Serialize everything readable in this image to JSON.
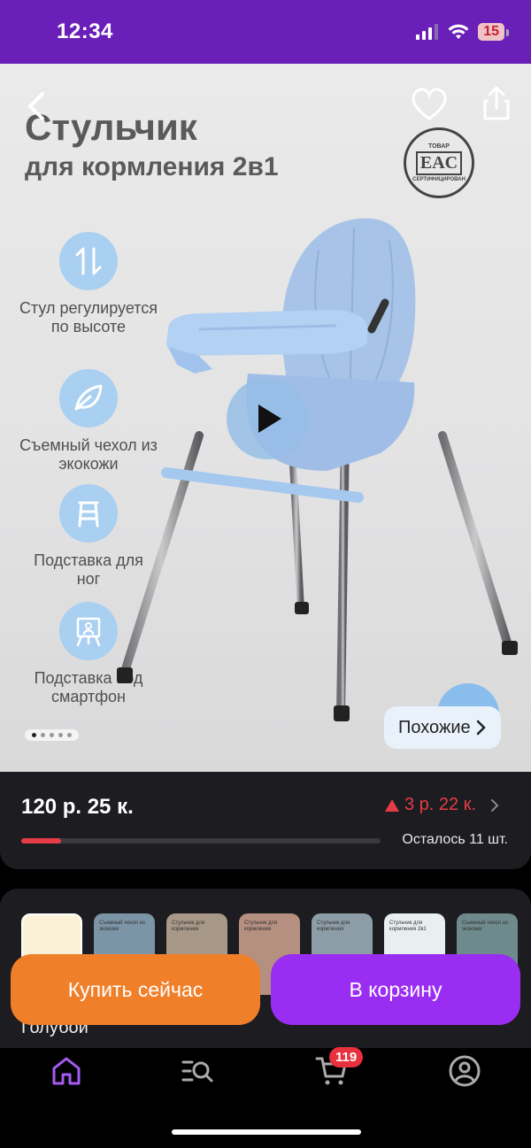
{
  "status_bar": {
    "time": "12:34",
    "battery": "15"
  },
  "hero": {
    "title_line1": "Стульчик",
    "title_line2": "для кормления 2в1",
    "stamp_top": "ТОВАР",
    "stamp_mark": "EAC",
    "stamp_bottom": "СЕРТИФИЦИРОВАН",
    "features": [
      {
        "icon": "height-arrows-icon",
        "text": "Стул регулируется по высоте"
      },
      {
        "icon": "leaf-icon",
        "text": "Съемный чехол из экокожи"
      },
      {
        "icon": "stool-icon",
        "text": "Подставка для ног"
      },
      {
        "icon": "easel-phone-icon",
        "text": "Подставка под смартфон"
      }
    ],
    "similar_label": "Похожие",
    "carousel_dots": 5,
    "active_dot": 0
  },
  "price": {
    "main": "120 р.  25 к.",
    "delta": "3 р.  22 к.",
    "stock_text": "Осталось 11 шт.",
    "stock_fraction": 0.11
  },
  "variants": {
    "thumbs": [
      {
        "bg": "#fbf1d6",
        "label": ""
      },
      {
        "bg": "#7c95a6",
        "label": "Съемный чехол из экокожи"
      },
      {
        "bg": "#a89888",
        "label": "Стульчик для кормления"
      },
      {
        "bg": "#b58f80",
        "label": "Стульчик для кормления"
      },
      {
        "bg": "#8d9da8",
        "label": "Стульчик для кормления"
      },
      {
        "bg": "#e9eef0",
        "label": "Стульчик для кормления 2в1"
      },
      {
        "bg": "#6f8a8c",
        "label": "Съемный чехол из экокожи"
      }
    ],
    "color_name": "Голубой"
  },
  "actions": {
    "buy_now": "Купить сейчас",
    "add_to_cart": "В корзину"
  },
  "tabbar": {
    "cart_badge": "119"
  },
  "colors": {
    "accent_purple": "#9a2df2",
    "accent_orange": "#f07f2a",
    "alert_red": "#e53d47"
  }
}
